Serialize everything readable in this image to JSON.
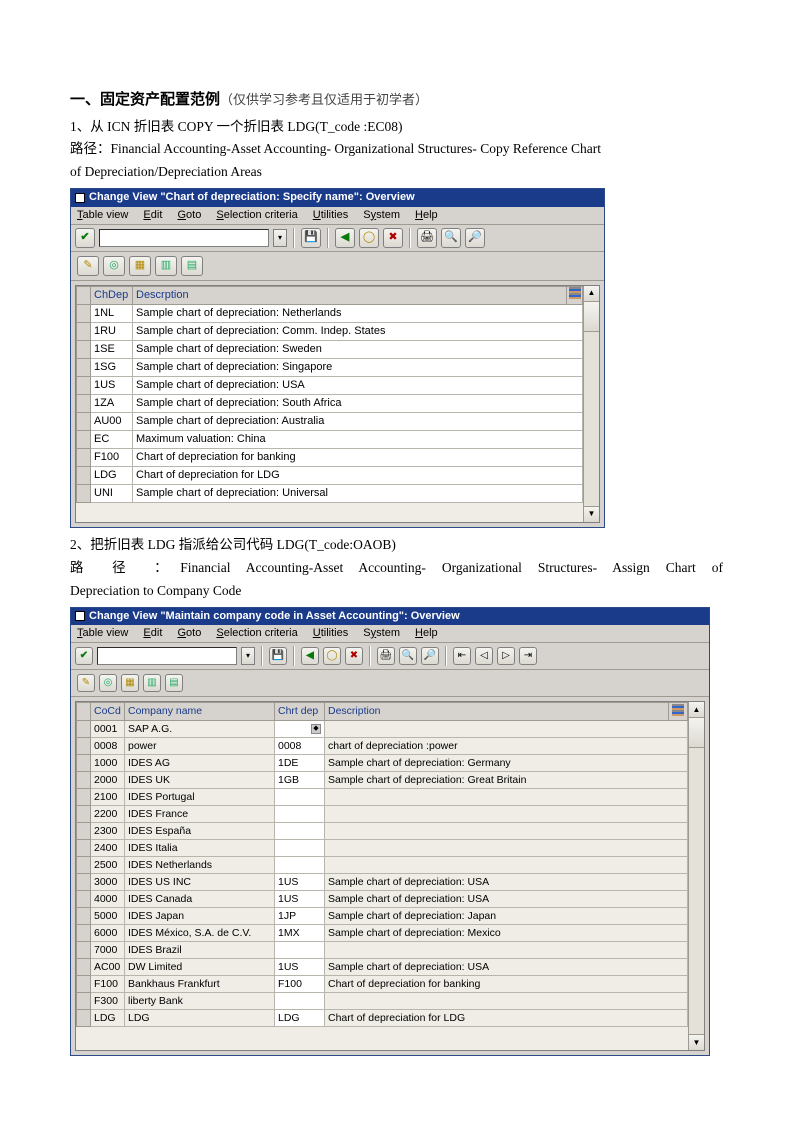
{
  "doc": {
    "heading_bold": "一、固定资产配置范例",
    "heading_note": "（仅供学习参考且仅适用于初学者）",
    "sec1_line1": "1、从 ICN 折旧表 COPY 一个折旧表 LDG(T_code :EC08)",
    "sec1_path_a": "路径：Financial Accounting-Asset Accounting- Organizational Structures- Copy Reference Chart",
    "sec1_path_b": "of Depreciation/Depreciation Areas",
    "sec2_line1": "2、把折旧表 LDG 指派给公司代码 LDG(T_code:OAOB)",
    "sec2_path_a": "路 径 ：Financial Accounting-Asset Accounting- Organizational Structures- Assign Chart of",
    "sec2_path_b": "Depreciation to Company Code"
  },
  "win1": {
    "title": "Change View \"Chart of depreciation: Specify name\": Overview",
    "menus": [
      "Table view",
      "Edit",
      "Goto",
      "Selection criteria",
      "Utilities",
      "System",
      "Help"
    ],
    "cols": {
      "code": "ChDep",
      "desc": "Descrption"
    },
    "rows": [
      {
        "code": "1NL",
        "desc": "Sample chart of depreciation: Netherlands"
      },
      {
        "code": "1RU",
        "desc": "Sample chart of depreciation: Comm. Indep. States"
      },
      {
        "code": "1SE",
        "desc": "Sample chart of depreciation: Sweden"
      },
      {
        "code": "1SG",
        "desc": "Sample chart of depreciation: Singapore"
      },
      {
        "code": "1US",
        "desc": "Sample chart of depreciation: USA"
      },
      {
        "code": "1ZA",
        "desc": "Sample chart of depreciation: South Africa"
      },
      {
        "code": "AU00",
        "desc": "Sample chart of depreciation: Australia"
      },
      {
        "code": "EC",
        "desc": "Maximum valuation: China"
      },
      {
        "code": "F100",
        "desc": "Chart of depreciation for banking"
      },
      {
        "code": "LDG",
        "desc": "Chart of depreciation for LDG"
      },
      {
        "code": "UNI",
        "desc": "Sample chart of depreciation: Universal"
      }
    ]
  },
  "win2": {
    "title": "Change View \"Maintain company code in Asset Accounting\": Overview",
    "menus": [
      "Table view",
      "Edit",
      "Goto",
      "Selection criteria",
      "Utilities",
      "System",
      "Help"
    ],
    "cols": {
      "co": "CoCd",
      "name": "Company name",
      "dep": "Chrt dep",
      "desc": "Description"
    },
    "rows": [
      {
        "co": "0001",
        "name": "SAP A.G.",
        "dep": "",
        "desc": "",
        "f4": true
      },
      {
        "co": "0008",
        "name": "power",
        "dep": "0008",
        "desc": "chart of depreciation :power"
      },
      {
        "co": "1000",
        "name": "IDES AG",
        "dep": "1DE",
        "desc": "Sample chart of depreciation: Germany"
      },
      {
        "co": "2000",
        "name": "IDES UK",
        "dep": "1GB",
        "desc": "Sample chart of depreciation: Great Britain"
      },
      {
        "co": "2100",
        "name": "IDES Portugal",
        "dep": "",
        "desc": ""
      },
      {
        "co": "2200",
        "name": "IDES France",
        "dep": "",
        "desc": ""
      },
      {
        "co": "2300",
        "name": "IDES España",
        "dep": "",
        "desc": ""
      },
      {
        "co": "2400",
        "name": "IDES Italia",
        "dep": "",
        "desc": ""
      },
      {
        "co": "2500",
        "name": "IDES Netherlands",
        "dep": "",
        "desc": ""
      },
      {
        "co": "3000",
        "name": "IDES US INC",
        "dep": "1US",
        "desc": "Sample chart of depreciation: USA"
      },
      {
        "co": "4000",
        "name": "IDES Canada",
        "dep": "1US",
        "desc": "Sample chart of depreciation: USA"
      },
      {
        "co": "5000",
        "name": "IDES Japan",
        "dep": "1JP",
        "desc": "Sample chart of depreciation: Japan"
      },
      {
        "co": "6000",
        "name": "IDES México, S.A. de C.V.",
        "dep": "1MX",
        "desc": "Sample chart of depreciation: Mexico"
      },
      {
        "co": "7000",
        "name": "IDES Brazil",
        "dep": "",
        "desc": ""
      },
      {
        "co": "AC00",
        "name": "DW Limited",
        "dep": "1US",
        "desc": "Sample chart of depreciation: USA"
      },
      {
        "co": "F100",
        "name": "Bankhaus Frankfurt",
        "dep": "F100",
        "desc": "Chart of depreciation for banking"
      },
      {
        "co": "F300",
        "name": "liberty Bank",
        "dep": "",
        "desc": ""
      },
      {
        "co": "LDG",
        "name": "LDG",
        "dep": "LDG",
        "desc": "Chart of depreciation for LDG"
      }
    ]
  }
}
